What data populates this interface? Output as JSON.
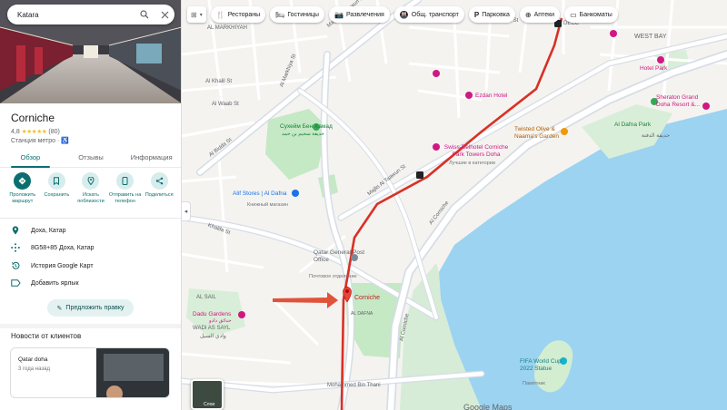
{
  "search": {
    "query": "Katara"
  },
  "place": {
    "title": "Corniche",
    "rating": "4,8",
    "stars": "★★★★★",
    "review_count": "(80)",
    "category": "Станция метро · ♿"
  },
  "tabs": [
    {
      "label": "Обзор",
      "active": true
    },
    {
      "label": "Отзывы",
      "active": false
    },
    {
      "label": "Информация",
      "active": false
    }
  ],
  "actions": [
    {
      "label": "Проложить маршрут",
      "icon": "directions-icon"
    },
    {
      "label": "Сохранить",
      "icon": "bookmark-icon"
    },
    {
      "label": "Искать поблизости",
      "icon": "nearby-icon"
    },
    {
      "label": "Отправить на телефон",
      "icon": "send-to-phone-icon"
    },
    {
      "label": "Поделиться",
      "icon": "share-icon"
    }
  ],
  "info": [
    {
      "text": "Доха, Катар",
      "icon": "location-pin-icon"
    },
    {
      "text": "8G58+85 Доха, Катар",
      "icon": "plus-code-icon"
    },
    {
      "text": "История Google Карт",
      "icon": "history-icon"
    },
    {
      "text": "Добавить ярлык",
      "icon": "label-icon"
    }
  ],
  "suggest_edit": "Предложить правку",
  "news": {
    "title": "Новости от клиентов",
    "card_title": "Qatar doha",
    "card_time": "3 года назад"
  },
  "chips": [
    {
      "label": "Рестораны",
      "icon": "restaurant-icon"
    },
    {
      "label": "Гостиницы",
      "icon": "hotel-icon"
    },
    {
      "label": "Развлечения",
      "icon": "camera-icon"
    },
    {
      "label": "Общ. транспорт",
      "icon": "transit-icon"
    },
    {
      "label": "Парковка",
      "icon": "parking-icon"
    },
    {
      "label": "Аптеки",
      "icon": "pharmacy-icon"
    },
    {
      "label": "Банкоматы",
      "icon": "atm-icon"
    }
  ],
  "map_labels": {
    "al_markhiyah": "AL MARKHIYAH",
    "al_khalil": "Al Khalil St",
    "al_waab": "Al Waab St",
    "al_markhiya_st": "Al Markhiya St",
    "al_bidda": "Al Bidda St",
    "khalifa": "Khalifa St",
    "al_sail": "AL SAIL",
    "wadi_as_sayl": "WADI AS SAYL",
    "wadi_ar": "وادي السيل",
    "al_dafna_st": "Al Dafna St",
    "majlis": "Majlis Al Taawun St",
    "al_corniche": "Al Corniche",
    "al_corniche_2": "Al Corniche",
    "west_bay": "WEST BAY",
    "mohammed_bin_thani": "Mohammed Bin Thani",
    "al_dafna_area": "AL DAFNA",
    "decc": "DECC",
    "street_label_1": "Majlis Al Taawun St",
    "dafna_park_ar": "حديقة الدفنة"
  },
  "pois": {
    "park_suhaim": "Сухейм Бен Хамад",
    "park_suhaim_ar": "حديقة سحيم بن حمد",
    "alif": "Alif Stores | Al Dafna",
    "alif_sub": "Книжный магазин",
    "qatar_post": "Qatar General Post Office",
    "qatar_post_sub": "Почтовое отделение",
    "corniche": "Corniche",
    "dadu": "Dadu Gardens",
    "dadu_ar": "حدائق دادو",
    "ezdan": "Ezdan Hotel",
    "swiss": "Swiss-Belhotel Corniche Park Towers Doha",
    "swiss_sub": "Лучшие в категории",
    "twisted": "Twisted Olive & Naama's Garden",
    "hotel_park": "Hotel Park",
    "sheraton": "Sheraton Grand Doha Resort &...",
    "dafna_park": "Al Dafna Park",
    "fifa": "FIFA World Cup 2022 Statue",
    "fifa_sub": "Памятник"
  },
  "layers_label": "Слои",
  "google_logo": "Google Maps",
  "colors": {
    "accent": "#0b6e6e",
    "metro_line": "#d93025",
    "water": "#9cd3f0",
    "park": "#c5e8c5",
    "road": "#ffffff",
    "major_road": "#d6dde6",
    "poi_pink": "#d01884"
  }
}
